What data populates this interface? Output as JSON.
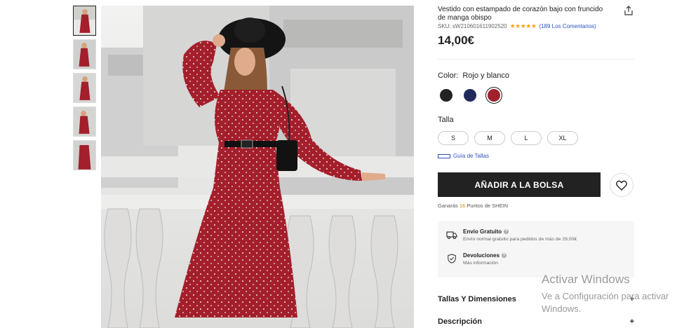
{
  "product": {
    "title": "Vestido con estampado de corazón bajo con fruncido de manga obispo",
    "sku": "SKU: sW2106016119025​20",
    "rating_stars": "★★★★★",
    "reviews": "(189 Los Comentarios)",
    "price": "14,00€"
  },
  "color": {
    "label": "Color:",
    "selected": "Rojo y blanco",
    "swatches": [
      "#222222",
      "#1f2a5a",
      "#a0212d"
    ]
  },
  "size": {
    "label": "Talla",
    "options": [
      "S",
      "M",
      "L",
      "XL"
    ],
    "guide": "Guía de Tallas"
  },
  "actions": {
    "add_to_bag": "AÑADIR A LA BOLSA"
  },
  "points": {
    "prefix": "Ganarás",
    "amount": "16",
    "suffix": "Puntos de SHEIN"
  },
  "shipping": {
    "title": "Envío Gratuito",
    "subtitle": "Envío normal gratuito para pedidos de más de 29,00€"
  },
  "returns": {
    "title": "Devoluciones",
    "subtitle": "Más información"
  },
  "accordions": {
    "sizes": "Tallas Y Dimensiones",
    "description": "Descripción",
    "plus": "+"
  },
  "windows_watermark": {
    "line1": "Activar Windows",
    "line2": "Ve a Configuración para activar",
    "line3": "Windows."
  },
  "icons": [
    "share-icon",
    "heart-icon",
    "truck-icon",
    "shield-check-icon",
    "ruler-icon",
    "help-icon"
  ]
}
